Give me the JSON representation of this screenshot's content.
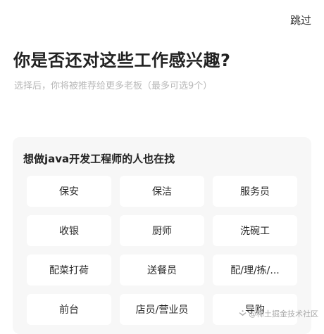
{
  "header": {
    "skip_label": "跳过",
    "title": "你是否还对这些工作感兴趣?",
    "subtitle": "选择后，你将被推荐给更多老板（最多可选9个）"
  },
  "card": {
    "title": "想做java开发工程师的人也在找",
    "jobs": [
      {
        "label": "保安"
      },
      {
        "label": "保洁"
      },
      {
        "label": "服务员"
      },
      {
        "label": "收银"
      },
      {
        "label": "厨师"
      },
      {
        "label": "洗碗工"
      },
      {
        "label": "配菜打荷"
      },
      {
        "label": "送餐员"
      },
      {
        "label": "配/理/拣/..."
      },
      {
        "label": "前台"
      },
      {
        "label": "店员/营业员"
      },
      {
        "label": "导购"
      }
    ]
  },
  "watermark": {
    "text": "@稀土掘金技术社区",
    "icon": "juejin-logo-icon"
  }
}
